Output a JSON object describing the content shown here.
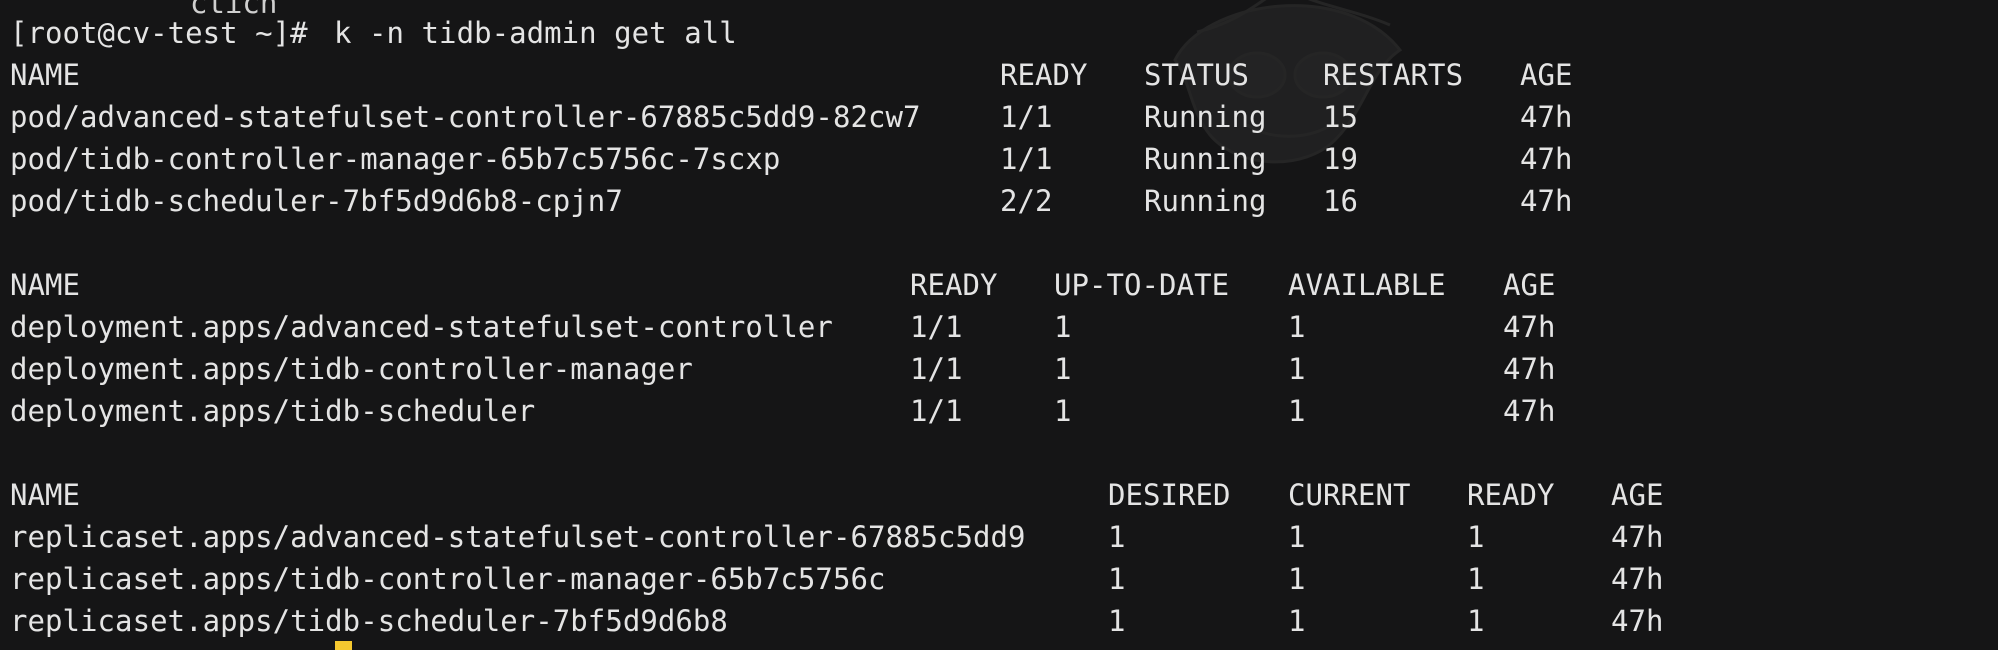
{
  "terminal": {
    "previous_output_fragment": "ctich",
    "prompt": "[root@cv-test ~]#",
    "command": "k -n tidb-admin get all",
    "watermark_icon": "ghost-face-icon",
    "cursor_color": "#f5c82f",
    "pods": {
      "headers": [
        "NAME",
        "READY",
        "STATUS",
        "RESTARTS",
        "AGE"
      ],
      "rows": [
        [
          "pod/advanced-statefulset-controller-67885c5dd9-82cw7",
          "1/1",
          "Running",
          "15",
          "47h"
        ],
        [
          "pod/tidb-controller-manager-65b7c5756c-7scxp",
          "1/1",
          "Running",
          "19",
          "47h"
        ],
        [
          "pod/tidb-scheduler-7bf5d9d6b8-cpjn7",
          "2/2",
          "Running",
          "16",
          "47h"
        ]
      ]
    },
    "deployments": {
      "headers": [
        "NAME",
        "READY",
        "UP-TO-DATE",
        "AVAILABLE",
        "AGE"
      ],
      "rows": [
        [
          "deployment.apps/advanced-statefulset-controller",
          "1/1",
          "1",
          "1",
          "47h"
        ],
        [
          "deployment.apps/tidb-controller-manager",
          "1/1",
          "1",
          "1",
          "47h"
        ],
        [
          "deployment.apps/tidb-scheduler",
          "1/1",
          "1",
          "1",
          "47h"
        ]
      ]
    },
    "replicasets": {
      "headers": [
        "NAME",
        "DESIRED",
        "CURRENT",
        "READY",
        "AGE"
      ],
      "rows": [
        [
          "replicaset.apps/advanced-statefulset-controller-67885c5dd9",
          "1",
          "1",
          "1",
          "47h"
        ],
        [
          "replicaset.apps/tidb-controller-manager-65b7c5756c",
          "1",
          "1",
          "1",
          "47h"
        ],
        [
          "replicaset.apps/tidb-scheduler-7bf5d9d6b8",
          "1",
          "1",
          "1",
          "47h"
        ]
      ]
    }
  }
}
